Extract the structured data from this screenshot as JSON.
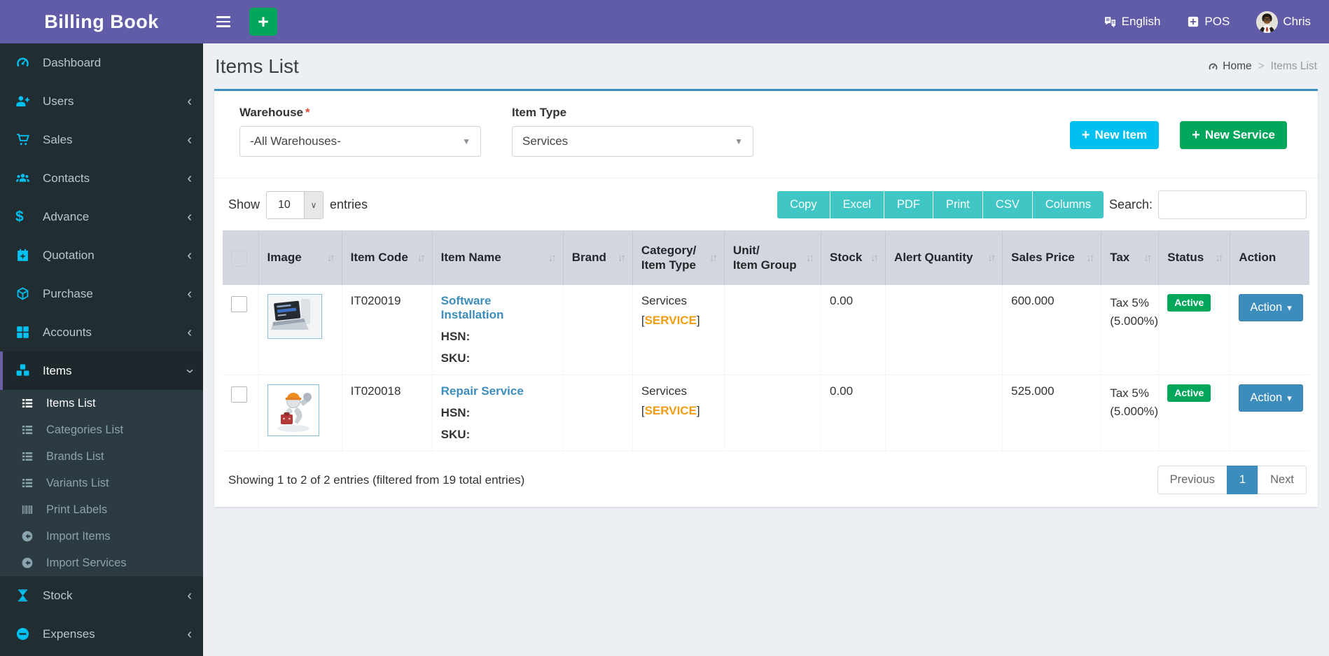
{
  "colors": {
    "navbar_purple": "#605ca8",
    "sidebar_dark": "#222d32",
    "sidebar_icon_cyan": "#00c0ef",
    "box_accent_blue": "#3c8dbc",
    "info_cyan": "#00c0ef",
    "success_green": "#00a65a",
    "export_teal": "#41c6c6",
    "tag_orange": "#f39c12",
    "table_header_gray": "#d2d6de",
    "required_red": "#dd4b39"
  },
  "navbar": {
    "brand": "Billing Book",
    "language": "English",
    "pos": "POS",
    "user": "Chris"
  },
  "sidebar": {
    "items": [
      {
        "label": "Dashboard",
        "icon": "dashboard-icon"
      },
      {
        "label": "Users",
        "icon": "user-plus-icon"
      },
      {
        "label": "Sales",
        "icon": "cart-icon"
      },
      {
        "label": "Contacts",
        "icon": "users-icon"
      },
      {
        "label": "Advance",
        "icon": "dollar-icon"
      },
      {
        "label": "Quotation",
        "icon": "calendar-plus-icon"
      },
      {
        "label": "Purchase",
        "icon": "cube-icon"
      },
      {
        "label": "Accounts",
        "icon": "grid-icon"
      },
      {
        "label": "Items",
        "icon": "cubes-icon"
      },
      {
        "label": "Stock",
        "icon": "hourglass-icon"
      },
      {
        "label": "Expenses",
        "icon": "minus-circle-icon"
      }
    ],
    "items_submenu": [
      {
        "label": "Items List",
        "icon": "list-icon"
      },
      {
        "label": "Categories List",
        "icon": "list-icon"
      },
      {
        "label": "Brands List",
        "icon": "list-icon"
      },
      {
        "label": "Variants List",
        "icon": "list-icon"
      },
      {
        "label": "Print Labels",
        "icon": "barcode-icon"
      },
      {
        "label": "Import Items",
        "icon": "import-icon"
      },
      {
        "label": "Import Services",
        "icon": "import-icon"
      }
    ]
  },
  "page": {
    "title": "Items List",
    "breadcrumb_home": "Home",
    "breadcrumb_separator": ">",
    "breadcrumb_current": "Items List"
  },
  "filters": {
    "warehouse_label": "Warehouse",
    "required_mark": "*",
    "warehouse_value": "-All Warehouses-",
    "item_type_label": "Item Type",
    "item_type_value": "Services",
    "new_item_label": "New Item",
    "new_service_label": "New Service",
    "plus_glyph": "+"
  },
  "controls": {
    "show_label": "Show",
    "page_length": "10",
    "entries_label": "entries",
    "export_buttons": [
      "Copy",
      "Excel",
      "PDF",
      "Print",
      "CSV",
      "Columns"
    ],
    "search_label": "Search:",
    "search_value": ""
  },
  "table": {
    "columns": [
      {
        "line1": "Image"
      },
      {
        "line1": "Item Code"
      },
      {
        "line1": "Item Name"
      },
      {
        "line1": "Brand"
      },
      {
        "line1": "Category/",
        "line2": "Item Type"
      },
      {
        "line1": "Unit/",
        "line2": "Item Group"
      },
      {
        "line1": "Stock"
      },
      {
        "line1": "Alert Quantity"
      },
      {
        "line1": "Sales Price"
      },
      {
        "line1": "Tax"
      },
      {
        "line1": "Status"
      },
      {
        "line1": "Action"
      }
    ],
    "labels": {
      "hsn": "HSN:",
      "sku": "SKU:",
      "bracket_open": "[",
      "bracket_close": "]"
    },
    "rows": [
      {
        "item_code": "IT020019",
        "item_name": "Software Installation",
        "brand": "",
        "category": "Services",
        "category_tag": "SERVICE",
        "unit_group": "",
        "stock": "0.00",
        "alert_quantity": "",
        "sales_price": "600.000",
        "tax_line1": "Tax 5%",
        "tax_line2": "(5.000%)",
        "status": "Active",
        "action": "Action",
        "image": "laptop-photo"
      },
      {
        "item_code": "IT020018",
        "item_name": "Repair Service",
        "brand": "",
        "category": "Services",
        "category_tag": "SERVICE",
        "unit_group": "",
        "stock": "0.00",
        "alert_quantity": "",
        "sales_price": "525.000",
        "tax_line1": "Tax 5%",
        "tax_line2": "(5.000%)",
        "status": "Active",
        "action": "Action",
        "image": "repair-mascot"
      }
    ],
    "summary": "Showing 1 to 2 of 2 entries (filtered from 19 total entries)",
    "pagination": {
      "previous": "Previous",
      "page": "1",
      "next": "Next"
    }
  }
}
